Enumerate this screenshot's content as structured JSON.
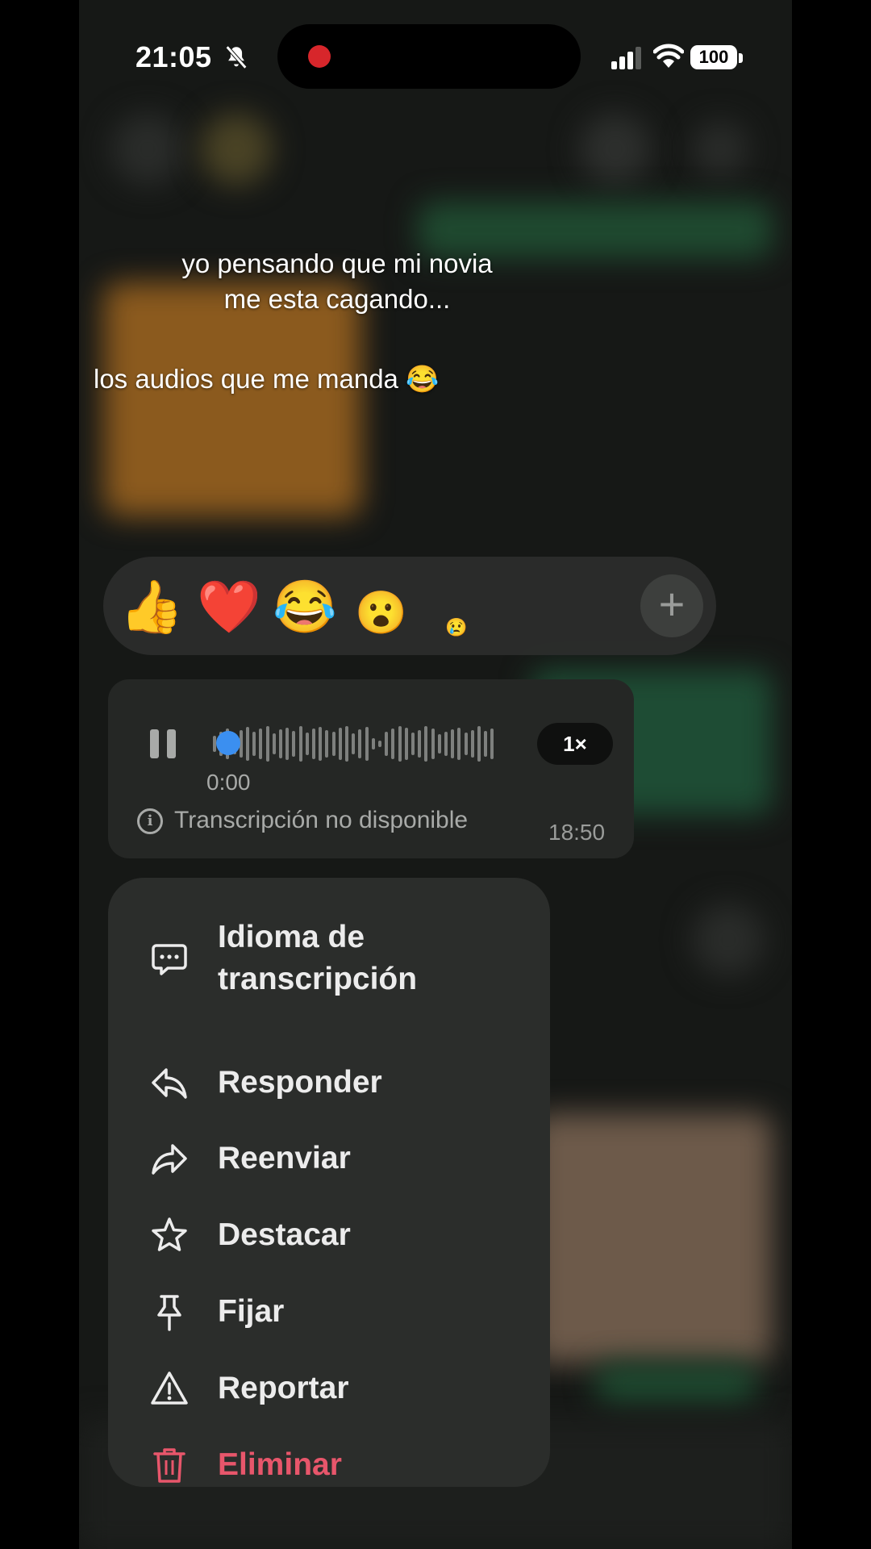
{
  "status_bar": {
    "time": "21:05",
    "battery": "100"
  },
  "caption": {
    "line1": "yo pensando que mi novia",
    "line2": "me esta cagando...",
    "line3": "los audios que me manda 😂"
  },
  "reactions": {
    "items": [
      "👍",
      "❤️",
      "😂",
      "😮",
      "😢"
    ],
    "add_label": "+"
  },
  "voice_message": {
    "elapsed": "0:00",
    "speed": "1×",
    "transcription_notice": "Transcripción no disponible",
    "sent_time": "18:50",
    "progress": 0
  },
  "context_menu": {
    "items": [
      {
        "label": "Idioma de transcripción",
        "icon": "chat-bubble-icon"
      },
      {
        "label": "Responder",
        "icon": "reply-icon"
      },
      {
        "label": "Reenviar",
        "icon": "forward-icon"
      },
      {
        "label": "Destacar",
        "icon": "star-icon"
      },
      {
        "label": "Fijar",
        "icon": "pin-icon"
      },
      {
        "label": "Reportar",
        "icon": "warning-icon"
      },
      {
        "label": "Eliminar",
        "icon": "trash-icon"
      }
    ]
  },
  "colors": {
    "accent_blue": "#3b8ff0",
    "danger": "#e8566b",
    "recording": "#d7262b"
  }
}
